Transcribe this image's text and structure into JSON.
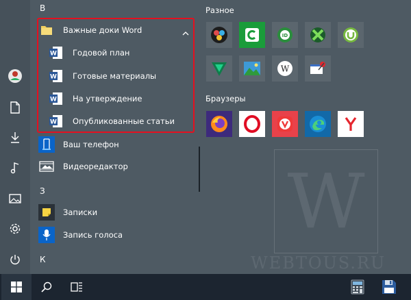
{
  "rail": {
    "icons": [
      "user-avatar-icon",
      "document-icon",
      "download-icon",
      "music-icon",
      "pictures-icon",
      "settings-icon",
      "power-icon"
    ]
  },
  "applist": {
    "letters": {
      "v": "В",
      "z": "З",
      "k": "К"
    },
    "folder": {
      "label": "Важные доки Word",
      "expanded": true
    },
    "folder_items": [
      {
        "label": "Годовой план",
        "icon": "word-document-icon"
      },
      {
        "label": "Готовые материалы",
        "icon": "word-document-icon"
      },
      {
        "label": "На утверждение",
        "icon": "word-document-icon"
      },
      {
        "label": "Опубликованные статьи",
        "icon": "word-document-icon"
      }
    ],
    "apps": [
      {
        "label": "Ваш телефон",
        "icon": "your-phone-icon"
      },
      {
        "label": "Видеоредактор",
        "icon": "video-editor-icon"
      },
      {
        "label": "Записки",
        "icon": "sticky-notes-icon"
      },
      {
        "label": "Запись голоса",
        "icon": "voice-recorder-icon"
      }
    ]
  },
  "groups": {
    "misc": {
      "title": "Разное",
      "tiles": [
        "davinci-resolve-icon",
        "camtasia-icon",
        "idm-icon",
        "xnview-icon",
        "utorrent-icon",
        "vectorworks-icon",
        "landscape-image-icon",
        "webtous-icon",
        "paint-icon"
      ]
    },
    "browsers": {
      "title": "Браузеры",
      "tiles": [
        "firefox-icon",
        "opera-icon",
        "vivaldi-icon",
        "edge-icon",
        "yandex-browser-icon"
      ]
    }
  },
  "watermark": {
    "letter": "W",
    "text": "WEBTOUS.RU"
  },
  "taskbar": {
    "items": [
      "windows-start-icon",
      "search-icon",
      "task-view-icon",
      "calculator-icon",
      "floppy-save-icon"
    ]
  },
  "colors": {
    "highlight": "#e5101f",
    "background": "#4e5a63",
    "taskbar": "#1c2530",
    "word_blue": "#2b5797",
    "folder_yellow": "#f2d060"
  }
}
